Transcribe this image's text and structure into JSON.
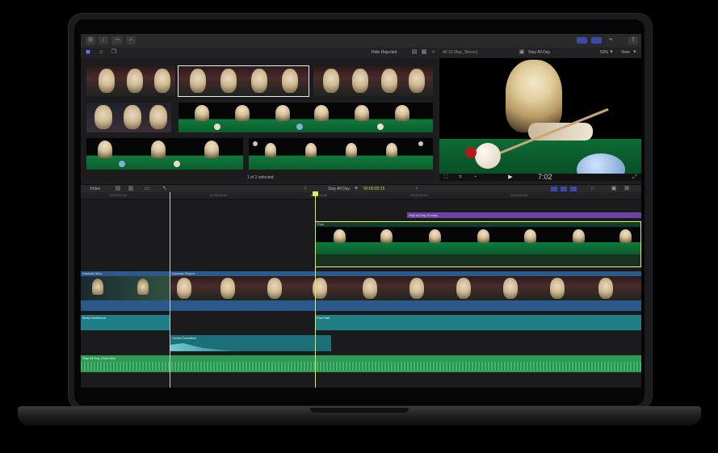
{
  "toolbar": {
    "hide_rejected": "Hide Rejected",
    "clip_name": "All 23 (Bay_Stereo)",
    "project_name": "Stay All Day",
    "zoom": "53%",
    "view_label": "View"
  },
  "browser": {
    "selection_status": "1 of 2 selected"
  },
  "viewer": {
    "timecode": "7:02"
  },
  "timeline_bar": {
    "index_label": "Index",
    "project_name": "Stay All Day",
    "duration": "00:00:00:15"
  },
  "ruler": {
    "ticks": [
      "00:00:00:00",
      "00:00:05:00",
      "00:00:10:00",
      "00:00:15:00",
      "00:00:20:00"
    ]
  },
  "clips": {
    "title_clip": "Stay All Day Sunday",
    "connected_label": "Pool",
    "primary_a": "Karaoke Mics",
    "primary_b": "Karaoke Rhyme",
    "audio_a": "Music Ambience",
    "audio_b": "Pool Hall",
    "effect": "Crowd Transition",
    "music": "Stay All Day (Total Mix)"
  },
  "colors": {
    "selection": "#f3f05a",
    "playhead": "#d6f25a",
    "primary_lane": "#2b5a8a",
    "audio_lane": "#1f7f86",
    "music_lane": "#2f9a56",
    "title_lane": "#7a4fb3"
  }
}
